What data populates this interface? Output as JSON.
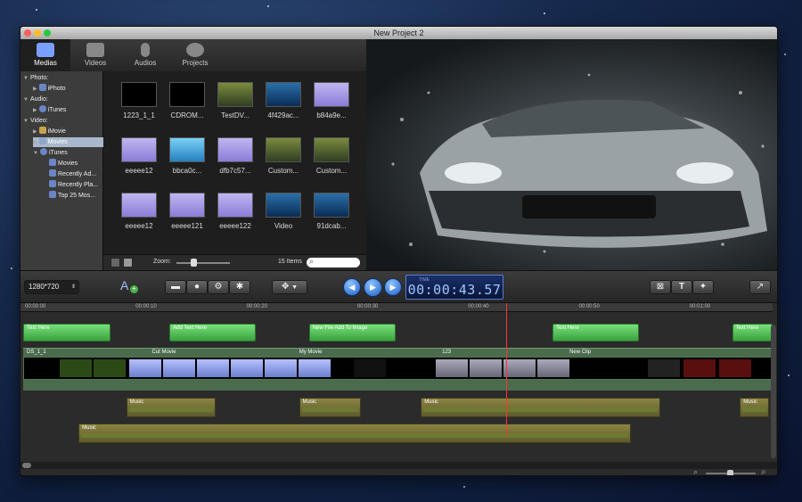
{
  "window": {
    "title": "New Project 2"
  },
  "toolbar": {
    "tabs": [
      {
        "label": "Medias",
        "icon": "media-icon",
        "active": true
      },
      {
        "label": "Videos",
        "icon": "video-camera-icon"
      },
      {
        "label": "Audios",
        "icon": "microphone-icon"
      },
      {
        "label": "Projects",
        "icon": "film-reel-icon"
      }
    ]
  },
  "sidebar": {
    "photo_header": "Photo:",
    "iphoto": "iPhoto",
    "audio_header": "Audio:",
    "itunes_audio": "iTunes",
    "video_header": "Video:",
    "imovie": "iMovie",
    "movies": "Movies",
    "itunes_video": "iTunes",
    "itunes_movies": "Movies",
    "recently_added": "Recently Ad...",
    "recently_played": "Recently Pla...",
    "top25": "Top 25 Mos..."
  },
  "media_grid": [
    {
      "name": "1223_1_1",
      "style": "black"
    },
    {
      "name": "CDROM...",
      "style": "black"
    },
    {
      "name": "TestDV...",
      "style": "tst"
    },
    {
      "name": "4f429ac...",
      "style": "blu"
    },
    {
      "name": "b84a9e...",
      "style": "pur"
    },
    {
      "name": "eeeee12",
      "style": "pur"
    },
    {
      "name": "bbca0c...",
      "style": "sky"
    },
    {
      "name": "dfb7c57...",
      "style": "pur"
    },
    {
      "name": "Custom...",
      "style": "tst"
    },
    {
      "name": "Custom...",
      "style": "tst"
    },
    {
      "name": "eeeee12",
      "style": "pur"
    },
    {
      "name": "eeeee121",
      "style": "pur"
    },
    {
      "name": "eeeee122",
      "style": "pur"
    },
    {
      "name": "Video",
      "style": "blu"
    },
    {
      "name": "91dcab...",
      "style": "blu"
    }
  ],
  "grid_footer": {
    "zoom_label": "Zoom:",
    "zoom_value": 0.3,
    "item_count": "15 Items",
    "search_placeholder": ""
  },
  "controls": {
    "resolution": "1280*720",
    "time_label": "TIME",
    "timecode": "00:00:43.57"
  },
  "timeline": {
    "ticks": [
      "00:00:00",
      "00:00:10",
      "00:00:20",
      "00:00:30",
      "00:00:40",
      "00:00:50",
      "00:01:00"
    ],
    "text_clips": [
      {
        "label": "Text Here",
        "start": 0,
        "end": 7.9
      },
      {
        "label": "Add Text Here",
        "start": 13.2,
        "end": 21
      },
      {
        "label": "New File Add To Image",
        "start": 25.8,
        "end": 33.6
      },
      {
        "label": "Text Here",
        "start": 47.8,
        "end": 55.6
      },
      {
        "label": "Text Here",
        "start": 64,
        "end": 68
      }
    ],
    "video_clips": [
      {
        "label": "DS_1_1",
        "start": 0
      },
      {
        "label": "Cut Movie",
        "start": 11.3
      },
      {
        "label": "My Movie",
        "start": 24.6
      },
      {
        "label": "123",
        "start": 37.5
      },
      {
        "label": "New Clip",
        "start": 49
      }
    ],
    "audio_clips": [
      {
        "label": "Music",
        "start": 9.3,
        "end": 17.4,
        "row": 0
      },
      {
        "label": "Music",
        "start": 24.9,
        "end": 30.5,
        "row": 0
      },
      {
        "label": "Music",
        "start": 35.9,
        "end": 57.5,
        "row": 0
      },
      {
        "label": "Music",
        "start": 64.7,
        "end": 68,
        "row": 0
      },
      {
        "label": "Music",
        "start": 5,
        "end": 54.9,
        "row": 1
      }
    ],
    "playhead_seconds": 43.57
  },
  "colors": {
    "accent": "#2e6fd8",
    "text_clip": "#5fc962",
    "audio_clip": "#837d3f"
  }
}
